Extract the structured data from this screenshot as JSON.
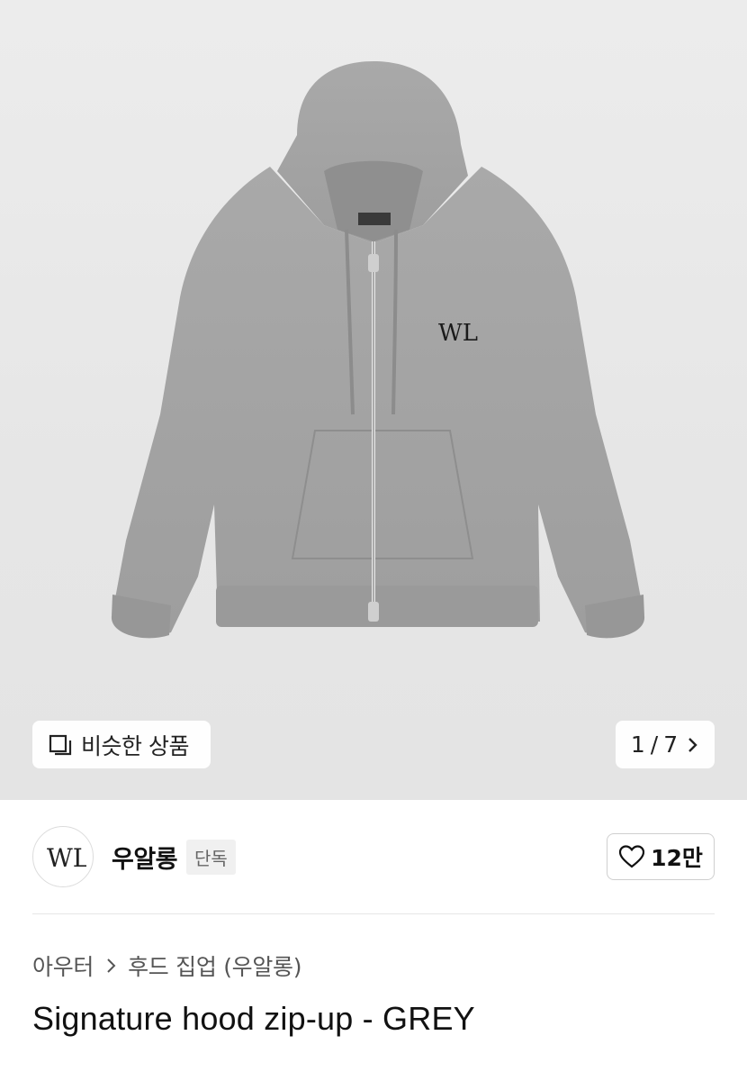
{
  "gallery": {
    "similar_label": "비슷한 상품",
    "current_page": "1",
    "separator": "/",
    "total_pages": "7",
    "icons": {
      "similar": "similar-items-icon",
      "next": "chevron-right-icon"
    },
    "product_logo_text": "WL"
  },
  "brand": {
    "name": "우알롱",
    "badge": "단독",
    "logo_text": "WL",
    "like_count": "12만",
    "like_icon": "heart-outline-icon"
  },
  "breadcrumb": {
    "items": [
      "아우터",
      "후드 집업 (우알롱)"
    ],
    "separator_icon": "chevron-right-icon"
  },
  "product": {
    "title": "Signature hood zip-up - GREY"
  },
  "colors": {
    "hoodie": "#a4a4a4",
    "background": "#e8e8e8",
    "text": "#111111"
  }
}
